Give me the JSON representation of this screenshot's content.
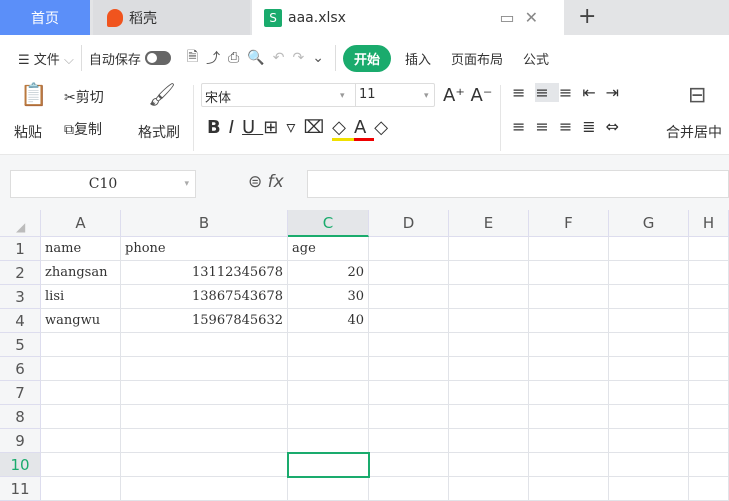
{
  "tabs": {
    "home": "首页",
    "docer": "稻壳",
    "file": "aaa.xlsx",
    "new_tab": "+"
  },
  "menu": {
    "file": "文件",
    "autosave": "自动保存",
    "start": "开始",
    "insert": "插入",
    "layout": "页面布局",
    "formula": "公式"
  },
  "ribbon": {
    "paste": "粘贴",
    "cut": "剪切",
    "copy": "复制",
    "format_painter": "格式刷",
    "font": "宋体",
    "size": "11",
    "merge": "合并居中"
  },
  "formula_bar": {
    "cell_ref": "C10",
    "fx": "fx",
    "value": ""
  },
  "sheet": {
    "columns": [
      "A",
      "B",
      "C",
      "D",
      "E",
      "F",
      "G",
      "H"
    ],
    "rows": [
      "1",
      "2",
      "3",
      "4",
      "5",
      "6",
      "7",
      "8",
      "9",
      "10",
      "11"
    ],
    "cells": [
      [
        "name",
        "phone",
        "age"
      ],
      [
        "zhangsan",
        "13112345678",
        "20"
      ],
      [
        "lisi",
        "13867543678",
        "30"
      ],
      [
        "wangwu",
        "15967845632",
        "40"
      ]
    ],
    "selected": "C10"
  }
}
